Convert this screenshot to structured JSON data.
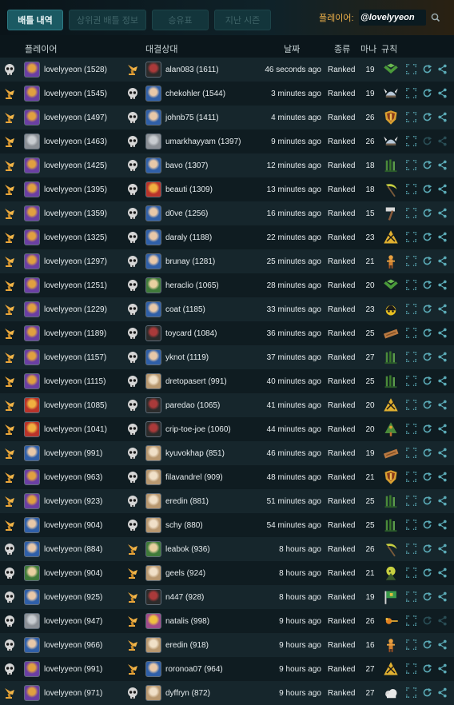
{
  "tabs": [
    {
      "label": "배틀 내역",
      "active": true
    },
    {
      "label": "상위권 배틀 정보",
      "active": false
    },
    {
      "label": "승유표",
      "active": false
    },
    {
      "label": "지난 시즌",
      "active": false
    }
  ],
  "player_label": "플레이어:",
  "player_value": "@lovelyyeon",
  "headers": {
    "player": "플레이어",
    "opponent": "대결상대",
    "date": "날짜",
    "type": "종류",
    "mana": "마나",
    "rules": "규칙"
  },
  "colors": {
    "win": "#e8a53a",
    "lose": "#d8d8d8",
    "accent": "#f0b24a",
    "action": "#5aa9b5"
  },
  "rows": [
    {
      "p_res": "lose",
      "player": "lovelyyeon (1528)",
      "o_res": "win",
      "opponent": "alan083 (1611)",
      "date": "46 seconds ago",
      "type": "Ranked",
      "mana": "19",
      "rule": "green-wings",
      "p_av": "purple",
      "o_av": "dark"
    },
    {
      "p_res": "win",
      "player": "lovelyyeon (1545)",
      "o_res": "lose",
      "opponent": "chekohler (1544)",
      "date": "3 minutes ago",
      "type": "Ranked",
      "mana": "19",
      "rule": "viking-helmet",
      "p_av": "purple",
      "o_av": "blue"
    },
    {
      "p_res": "win",
      "player": "lovelyyeon (1497)",
      "o_res": "lose",
      "opponent": "johnb75 (1411)",
      "date": "4 minutes ago",
      "type": "Ranked",
      "mana": "26",
      "rule": "shield",
      "p_av": "purple",
      "o_av": "blue"
    },
    {
      "p_res": "win",
      "player": "lovelyyeon (1463)",
      "o_res": "lose",
      "opponent": "umarkhayyam (1397)",
      "date": "9 minutes ago",
      "type": "Ranked",
      "mana": "26",
      "rule": "viking-helmet",
      "p_av": "grey",
      "o_av": "grey"
    },
    {
      "p_res": "win",
      "player": "lovelyyeon (1425)",
      "o_res": "lose",
      "opponent": "bavo (1307)",
      "date": "12 minutes ago",
      "type": "Ranked",
      "mana": "18",
      "rule": "green-bars",
      "p_av": "purple",
      "o_av": "blue"
    },
    {
      "p_res": "win",
      "player": "lovelyyeon (1395)",
      "o_res": "lose",
      "opponent": "beauti (1309)",
      "date": "13 minutes ago",
      "type": "Ranked",
      "mana": "18",
      "rule": "scythe",
      "p_av": "purple",
      "o_av": "red"
    },
    {
      "p_res": "win",
      "player": "lovelyyeon (1359)",
      "o_res": "lose",
      "opponent": "d0ve (1256)",
      "date": "16 minutes ago",
      "type": "Ranked",
      "mana": "15",
      "rule": "hammer",
      "p_av": "purple",
      "o_av": "blue"
    },
    {
      "p_res": "win",
      "player": "lovelyyeon (1325)",
      "o_res": "lose",
      "opponent": "daraly (1188)",
      "date": "22 minutes ago",
      "type": "Ranked",
      "mana": "23",
      "rule": "gold-swords",
      "p_av": "purple",
      "o_av": "blue"
    },
    {
      "p_res": "win",
      "player": "lovelyyeon (1297)",
      "o_res": "lose",
      "opponent": "brunay (1281)",
      "date": "25 minutes ago",
      "type": "Ranked",
      "mana": "21",
      "rule": "gold-figure",
      "p_av": "purple",
      "o_av": "blue"
    },
    {
      "p_res": "win",
      "player": "lovelyyeon (1251)",
      "o_res": "lose",
      "opponent": "heraclio (1065)",
      "date": "28 minutes ago",
      "type": "Ranked",
      "mana": "20",
      "rule": "green-wings",
      "p_av": "purple",
      "o_av": "green"
    },
    {
      "p_res": "win",
      "player": "lovelyyeon (1229)",
      "o_res": "lose",
      "opponent": "coat (1185)",
      "date": "33 minutes ago",
      "type": "Ranked",
      "mana": "23",
      "rule": "yellow-sun",
      "p_av": "purple",
      "o_av": "blue"
    },
    {
      "p_res": "win",
      "player": "lovelyyeon (1189)",
      "o_res": "lose",
      "opponent": "toycard (1084)",
      "date": "36 minutes ago",
      "type": "Ranked",
      "mana": "25",
      "rule": "wood-plank",
      "p_av": "purple",
      "o_av": "dark"
    },
    {
      "p_res": "win",
      "player": "lovelyyeon (1157)",
      "o_res": "lose",
      "opponent": "yknot (1119)",
      "date": "37 minutes ago",
      "type": "Ranked",
      "mana": "27",
      "rule": "green-bars",
      "p_av": "purple",
      "o_av": "blue"
    },
    {
      "p_res": "win",
      "player": "lovelyyeon (1115)",
      "o_res": "lose",
      "opponent": "dretopasert (991)",
      "date": "40 minutes ago",
      "type": "Ranked",
      "mana": "25",
      "rule": "green-bars",
      "p_av": "purple",
      "o_av": "tan"
    },
    {
      "p_res": "win",
      "player": "lovelyyeon (1085)",
      "o_res": "lose",
      "opponent": "paredao (1065)",
      "date": "41 minutes ago",
      "type": "Ranked",
      "mana": "20",
      "rule": "gold-swords",
      "p_av": "red",
      "o_av": "dark"
    },
    {
      "p_res": "win",
      "player": "lovelyyeon (1041)",
      "o_res": "lose",
      "opponent": "crip-toe-joe (1060)",
      "date": "44 minutes ago",
      "type": "Ranked",
      "mana": "20",
      "rule": "green-tree",
      "p_av": "red",
      "o_av": "dark"
    },
    {
      "p_res": "win",
      "player": "lovelyyeon (991)",
      "o_res": "lose",
      "opponent": "kyuvokhap (851)",
      "date": "46 minutes ago",
      "type": "Ranked",
      "mana": "19",
      "rule": "wood-plank",
      "p_av": "blue",
      "o_av": "tan"
    },
    {
      "p_res": "win",
      "player": "lovelyyeon (963)",
      "o_res": "lose",
      "opponent": "filavandrel (909)",
      "date": "48 minutes ago",
      "type": "Ranked",
      "mana": "21",
      "rule": "shield",
      "p_av": "purple",
      "o_av": "tan"
    },
    {
      "p_res": "win",
      "player": "lovelyyeon (923)",
      "o_res": "lose",
      "opponent": "eredin (881)",
      "date": "51 minutes ago",
      "type": "Ranked",
      "mana": "25",
      "rule": "green-bars",
      "p_av": "purple",
      "o_av": "tan"
    },
    {
      "p_res": "win",
      "player": "lovelyyeon (904)",
      "o_res": "lose",
      "opponent": "schy (880)",
      "date": "54 minutes ago",
      "type": "Ranked",
      "mana": "25",
      "rule": "green-bars",
      "p_av": "blue",
      "o_av": "tan"
    },
    {
      "p_res": "lose",
      "player": "lovelyyeon (884)",
      "o_res": "win",
      "opponent": "leabok (936)",
      "date": "8 hours ago",
      "type": "Ranked",
      "mana": "26",
      "rule": "scythe",
      "p_av": "blue",
      "o_av": "green"
    },
    {
      "p_res": "lose",
      "player": "lovelyyeon (904)",
      "o_res": "win",
      "opponent": "geels (924)",
      "date": "8 hours ago",
      "type": "Ranked",
      "mana": "21",
      "rule": "green-figure",
      "p_av": "green",
      "o_av": "tan"
    },
    {
      "p_res": "lose",
      "player": "lovelyyeon (925)",
      "o_res": "win",
      "opponent": "n447 (928)",
      "date": "8 hours ago",
      "type": "Ranked",
      "mana": "19",
      "rule": "green-flag",
      "p_av": "blue",
      "o_av": "dark"
    },
    {
      "p_res": "lose",
      "player": "lovelyyeon (947)",
      "o_res": "win",
      "opponent": "natalis (998)",
      "date": "9 hours ago",
      "type": "Ranked",
      "mana": "26",
      "rule": "spark",
      "p_av": "grey",
      "o_av": "pink"
    },
    {
      "p_res": "lose",
      "player": "lovelyyeon (966)",
      "o_res": "win",
      "opponent": "eredin (918)",
      "date": "9 hours ago",
      "type": "Ranked",
      "mana": "16",
      "rule": "gold-figure",
      "p_av": "blue",
      "o_av": "tan"
    },
    {
      "p_res": "lose",
      "player": "lovelyyeon (991)",
      "o_res": "win",
      "opponent": "roronoa07 (964)",
      "date": "9 hours ago",
      "type": "Ranked",
      "mana": "27",
      "rule": "gold-swords",
      "p_av": "purple",
      "o_av": "blue"
    },
    {
      "p_res": "win",
      "player": "lovelyyeon (971)",
      "o_res": "lose",
      "opponent": "dyffryn (872)",
      "date": "9 hours ago",
      "type": "Ranked",
      "mana": "27",
      "rule": "cloud",
      "p_av": "purple",
      "o_av": "tan"
    }
  ]
}
